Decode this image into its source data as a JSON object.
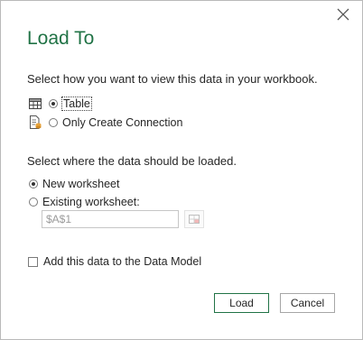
{
  "dialog": {
    "title": "Load To",
    "view_prompt": "Select how you want to view this data in your workbook.",
    "view_options": [
      {
        "label": "Table",
        "icon": "table-icon",
        "selected": true
      },
      {
        "label": "Only Create Connection",
        "icon": "connection-icon",
        "selected": false
      }
    ],
    "location_prompt": "Select where the data should be loaded.",
    "location_options": [
      {
        "label": "New worksheet",
        "selected": true
      },
      {
        "label": "Existing worksheet:",
        "selected": false
      }
    ],
    "cell_reference": "$A$1",
    "data_model_label": "Add this data to the Data Model",
    "data_model_checked": false,
    "buttons": {
      "load": "Load",
      "cancel": "Cancel"
    }
  },
  "colors": {
    "accent": "#217346",
    "text": "#262626",
    "muted": "#9a9a9a"
  }
}
